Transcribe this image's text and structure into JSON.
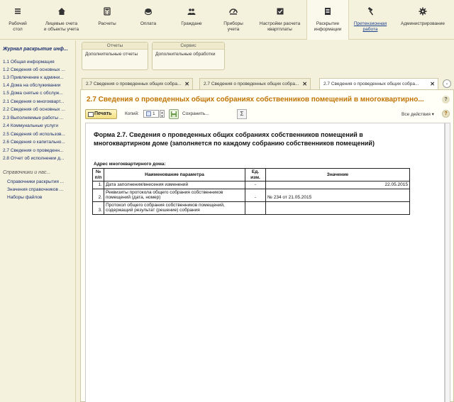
{
  "toolbar": {
    "items": [
      {
        "label": "Рабочий\nстол",
        "icon": "desktop-icon"
      },
      {
        "label": "Лицевые счета\nи объекты учета",
        "icon": "home-icon"
      },
      {
        "label": "Расчеты",
        "icon": "calculator-icon"
      },
      {
        "label": "Оплата",
        "icon": "coins-icon"
      },
      {
        "label": "Граждане",
        "icon": "people-icon"
      },
      {
        "label": "Приборы\nучета",
        "icon": "meter-icon"
      },
      {
        "label": "Настройки расчета\nквартплаты",
        "icon": "checkbox-icon"
      },
      {
        "label": "Раскрытие\nинформации",
        "icon": "document-icon"
      },
      {
        "label": "Претензионная\nработа",
        "icon": "hammer-icon"
      },
      {
        "label": "Администрирование",
        "icon": "gear-icon"
      }
    ]
  },
  "left_panel": {
    "title": "Журнал раскрытие инф...",
    "items": [
      "1.1 Общая информация",
      "1.2 Сведения об основных ...",
      "1.3 Привлечение к админи...",
      "1.4 Дома на обслуживании",
      "1.5 Дома снятые с обслуж...",
      "2.1 Сведения о многокварт...",
      "2.2 Сведения об основных ...",
      "2.3 Выполняемые работы ...",
      "2.4 Коммунальные услуги",
      "2.5 Сведения об использов...",
      "2.6 Сведения о капитально...",
      "2.7 Сведения о проведенн...",
      "2.8 Отчет об исполнении д..."
    ],
    "section": "Справочники и нас...",
    "sub_items": [
      "Справочники раскрытия ...",
      "Значения справочников ...",
      "Наборы файлов"
    ]
  },
  "subpanel": {
    "reports": {
      "header": "Отчеты",
      "item": "Дополнительные отчеты"
    },
    "service": {
      "header": "Сервис",
      "item": "Дополнительные обработки"
    }
  },
  "tabs": [
    {
      "label": "2.7 Сведения о проведенных общих собра..."
    },
    {
      "label": "2.7 Сведения о проведенных общих собра..."
    },
    {
      "label": "2.7 Сведения о проведенных общих собра..."
    }
  ],
  "document": {
    "title": "2.7 Сведения о проведенных общих собраниях собственников помещений в многоквартирно...",
    "print_label": "Печать",
    "copies_label": "Копий:",
    "copies_value": "1",
    "save_label": "Сохранить...",
    "sigma": "Σ",
    "all_actions": "Все действия ▾",
    "help": "?"
  },
  "form": {
    "heading": "Форма 2.7. Сведения о проведенных общих собраниях собственников помещений в многоквартирном доме (заполняется по каждому собранию собственников помещений)",
    "address_label": "Адрес многоквартирного дома:",
    "columns": [
      "№ п/п",
      "Наименование параметра",
      "Ед. изм.",
      "Значение"
    ],
    "rows": [
      {
        "n": "1.",
        "param": "Дата заполнения/внесения изменений",
        "unit": "-",
        "value": "22.05.2015"
      },
      {
        "n": "2.",
        "param": "Реквизиты протокола общего собрания собственников помещений (дата, номер)",
        "unit": "-",
        "value": "№ 234 от 21.05.2015"
      },
      {
        "n": "3.",
        "param": "Протокол общего собрания собственников помещений, содержащий результат (решение) собрания",
        "unit": "",
        "value": ""
      }
    ]
  }
}
